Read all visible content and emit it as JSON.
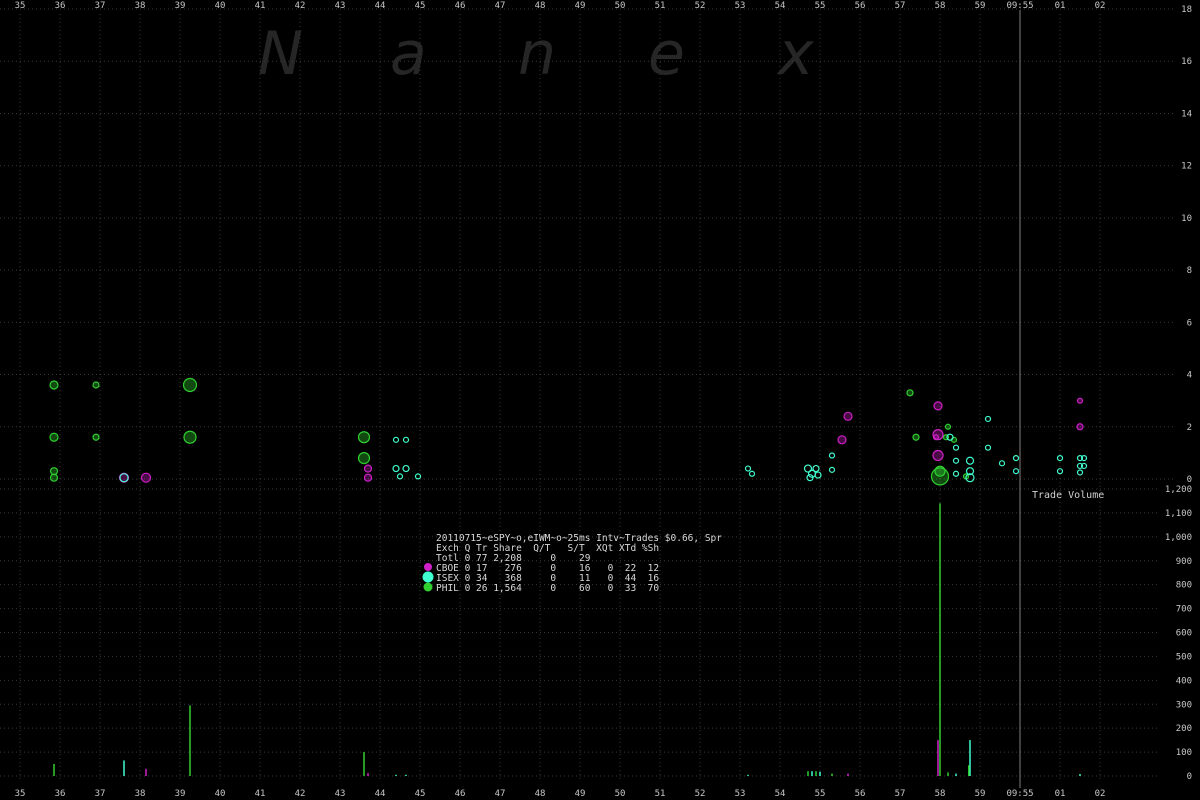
{
  "watermark": [
    "N",
    "a",
    "n",
    "e",
    "x"
  ],
  "colors": {
    "background": "#000000",
    "grid": "#3a3a3a",
    "CBOE": "#d020c8",
    "ISEX": "#40ffd0",
    "PHIL": "#30d030",
    "bar_phil": "#30d030",
    "bar_cboe": "#d020c8",
    "bar_isex": "#40ffd0",
    "time_line": "#808080"
  },
  "chart_data": {
    "type": "scatter",
    "x_ticks": [
      "35",
      "36",
      "37",
      "38",
      "39",
      "40",
      "41",
      "42",
      "43",
      "44",
      "45",
      "46",
      "47",
      "48",
      "49",
      "50",
      "51",
      "52",
      "53",
      "54",
      "55",
      "56",
      "57",
      "58",
      "59",
      "09:55",
      "01",
      "02"
    ],
    "price_axis": {
      "ticks": [
        "0",
        "2",
        "4",
        "6",
        "8",
        "10",
        "12",
        "14",
        "16",
        "18"
      ],
      "ylim": [
        0,
        18
      ]
    },
    "volume_axis": {
      "label": "Trade Volume",
      "ticks": [
        "0",
        "100",
        "200",
        "300",
        "400",
        "500",
        "600",
        "700",
        "800",
        "900",
        "1,000",
        "1,100",
        "1,200"
      ],
      "ylim": [
        0,
        1200
      ]
    },
    "marker_line_label": "09:55",
    "series": [
      {
        "name": "PHIL",
        "points": [
          {
            "x": 35.85,
            "y": 3.6,
            "s": 6
          },
          {
            "x": 35.85,
            "y": 1.6,
            "s": 6
          },
          {
            "x": 35.85,
            "y": 0.3,
            "s": 5
          },
          {
            "x": 35.85,
            "y": 0.05,
            "s": 5
          },
          {
            "x": 36.9,
            "y": 3.6,
            "s": 4
          },
          {
            "x": 36.9,
            "y": 1.6,
            "s": 4
          },
          {
            "x": 39.25,
            "y": 3.6,
            "s": 11
          },
          {
            "x": 39.25,
            "y": 1.6,
            "s": 10
          },
          {
            "x": 43.6,
            "y": 1.6,
            "s": 9
          },
          {
            "x": 43.6,
            "y": 0.8,
            "s": 9
          },
          {
            "x": 57.25,
            "y": 3.3,
            "s": 4
          },
          {
            "x": 57.4,
            "y": 1.6,
            "s": 4
          },
          {
            "x": 58.0,
            "y": 0.1,
            "s": 15
          },
          {
            "x": 58.0,
            "y": 0.3,
            "s": 8
          },
          {
            "x": 58.15,
            "y": 1.6,
            "s": 3
          },
          {
            "x": 58.2,
            "y": 2.0,
            "s": 3
          },
          {
            "x": 58.35,
            "y": 1.5,
            "s": 3
          },
          {
            "x": 58.65,
            "y": 0.1,
            "s": 3
          }
        ]
      },
      {
        "name": "CBOE",
        "points": [
          {
            "x": 37.6,
            "y": 0.05,
            "s": 7
          },
          {
            "x": 38.15,
            "y": 0.05,
            "s": 7
          },
          {
            "x": 43.7,
            "y": 0.4,
            "s": 5
          },
          {
            "x": 43.7,
            "y": 0.05,
            "s": 5
          },
          {
            "x": 55.55,
            "y": 1.5,
            "s": 6
          },
          {
            "x": 55.7,
            "y": 2.4,
            "s": 6
          },
          {
            "x": 57.95,
            "y": 2.8,
            "s": 6
          },
          {
            "x": 57.95,
            "y": 1.7,
            "s": 8
          },
          {
            "x": 57.95,
            "y": 0.9,
            "s": 8
          },
          {
            "x": 57.9,
            "y": 1.6,
            "s": 3
          },
          {
            "x": 61.5,
            "y": 3.0,
            "s": 3
          },
          {
            "x": 61.5,
            "y": 2.0,
            "s": 4
          }
        ]
      },
      {
        "name": "ISEX",
        "points": [
          {
            "x": 37.6,
            "y": 0.05,
            "s": 6
          },
          {
            "x": 44.4,
            "y": 1.5,
            "s": 3
          },
          {
            "x": 44.65,
            "y": 1.5,
            "s": 3
          },
          {
            "x": 44.4,
            "y": 0.4,
            "s": 4
          },
          {
            "x": 44.65,
            "y": 0.4,
            "s": 4
          },
          {
            "x": 44.5,
            "y": 0.1,
            "s": 3
          },
          {
            "x": 44.95,
            "y": 0.1,
            "s": 3
          },
          {
            "x": 53.2,
            "y": 0.4,
            "s": 3
          },
          {
            "x": 53.3,
            "y": 0.2,
            "s": 3
          },
          {
            "x": 54.7,
            "y": 0.4,
            "s": 5
          },
          {
            "x": 54.8,
            "y": 0.2,
            "s": 5
          },
          {
            "x": 54.9,
            "y": 0.4,
            "s": 4
          },
          {
            "x": 54.75,
            "y": 0.05,
            "s": 4
          },
          {
            "x": 54.95,
            "y": 0.15,
            "s": 4
          },
          {
            "x": 55.3,
            "y": 0.9,
            "s": 3
          },
          {
            "x": 55.3,
            "y": 0.35,
            "s": 3
          },
          {
            "x": 58.25,
            "y": 1.6,
            "s": 4
          },
          {
            "x": 58.4,
            "y": 1.2,
            "s": 3
          },
          {
            "x": 58.4,
            "y": 0.7,
            "s": 3
          },
          {
            "x": 58.4,
            "y": 0.2,
            "s": 3
          },
          {
            "x": 58.75,
            "y": 0.7,
            "s": 5
          },
          {
            "x": 58.75,
            "y": 0.3,
            "s": 5
          },
          {
            "x": 58.75,
            "y": 0.05,
            "s": 6
          },
          {
            "x": 59.2,
            "y": 2.3,
            "s": 3
          },
          {
            "x": 59.2,
            "y": 1.2,
            "s": 3
          },
          {
            "x": 59.55,
            "y": 0.6,
            "s": 3
          },
          {
            "x": 59.9,
            "y": 0.8,
            "s": 3
          },
          {
            "x": 59.9,
            "y": 0.3,
            "s": 3
          },
          {
            "x": 61.0,
            "y": 0.8,
            "s": 3
          },
          {
            "x": 61.0,
            "y": 0.3,
            "s": 3
          },
          {
            "x": 61.5,
            "y": 0.8,
            "s": 3
          },
          {
            "x": 61.5,
            "y": 0.5,
            "s": 3
          },
          {
            "x": 61.5,
            "y": 0.25,
            "s": 3
          },
          {
            "x": 61.6,
            "y": 0.8,
            "s": 3
          },
          {
            "x": 61.6,
            "y": 0.5,
            "s": 3
          }
        ]
      }
    ],
    "volume_bars": [
      {
        "x": 35.85,
        "v": 50,
        "c": "bar_phil"
      },
      {
        "x": 37.6,
        "v": 65,
        "c": "bar_isex"
      },
      {
        "x": 38.15,
        "v": 30,
        "c": "bar_cboe"
      },
      {
        "x": 39.25,
        "v": 295,
        "c": "bar_phil"
      },
      {
        "x": 43.6,
        "v": 100,
        "c": "bar_phil"
      },
      {
        "x": 43.7,
        "v": 12,
        "c": "bar_cboe"
      },
      {
        "x": 44.4,
        "v": 5,
        "c": "bar_isex"
      },
      {
        "x": 44.65,
        "v": 5,
        "c": "bar_isex"
      },
      {
        "x": 53.2,
        "v": 5,
        "c": "bar_isex"
      },
      {
        "x": 54.7,
        "v": 20,
        "c": "bar_phil"
      },
      {
        "x": 54.8,
        "v": 20,
        "c": "bar_isex"
      },
      {
        "x": 54.9,
        "v": 20,
        "c": "bar_phil"
      },
      {
        "x": 55.0,
        "v": 18,
        "c": "bar_isex"
      },
      {
        "x": 55.3,
        "v": 10,
        "c": "bar_phil"
      },
      {
        "x": 55.7,
        "v": 10,
        "c": "bar_cboe"
      },
      {
        "x": 57.95,
        "v": 150,
        "c": "bar_cboe"
      },
      {
        "x": 58.0,
        "v": 1140,
        "c": "bar_phil"
      },
      {
        "x": 58.2,
        "v": 15,
        "c": "bar_phil"
      },
      {
        "x": 58.4,
        "v": 10,
        "c": "bar_isex"
      },
      {
        "x": 58.75,
        "v": 150,
        "c": "bar_isex"
      },
      {
        "x": 58.72,
        "v": 45,
        "c": "bar_phil"
      },
      {
        "x": 61.5,
        "v": 8,
        "c": "bar_isex"
      }
    ]
  },
  "info_table": {
    "title": "20110715~eSPY~o,eIWM~o~25ms Intv~Trades $0.66, Spr",
    "header": "Exch Q Tr Share  Q/T   S/T  XQt XTd %Sh",
    "rows": [
      {
        "name": "Totl",
        "text": "Totl 0 77 2,208     0    29"
      },
      {
        "name": "CBOE",
        "text": "CBOE 0 17   276     0    16   0  22  12"
      },
      {
        "name": "ISEX",
        "text": "ISEX 0 34   368     0    11   0  44  16"
      },
      {
        "name": "PHIL",
        "text": "PHIL 0 26 1,564     0    60   0  33  70"
      }
    ]
  }
}
